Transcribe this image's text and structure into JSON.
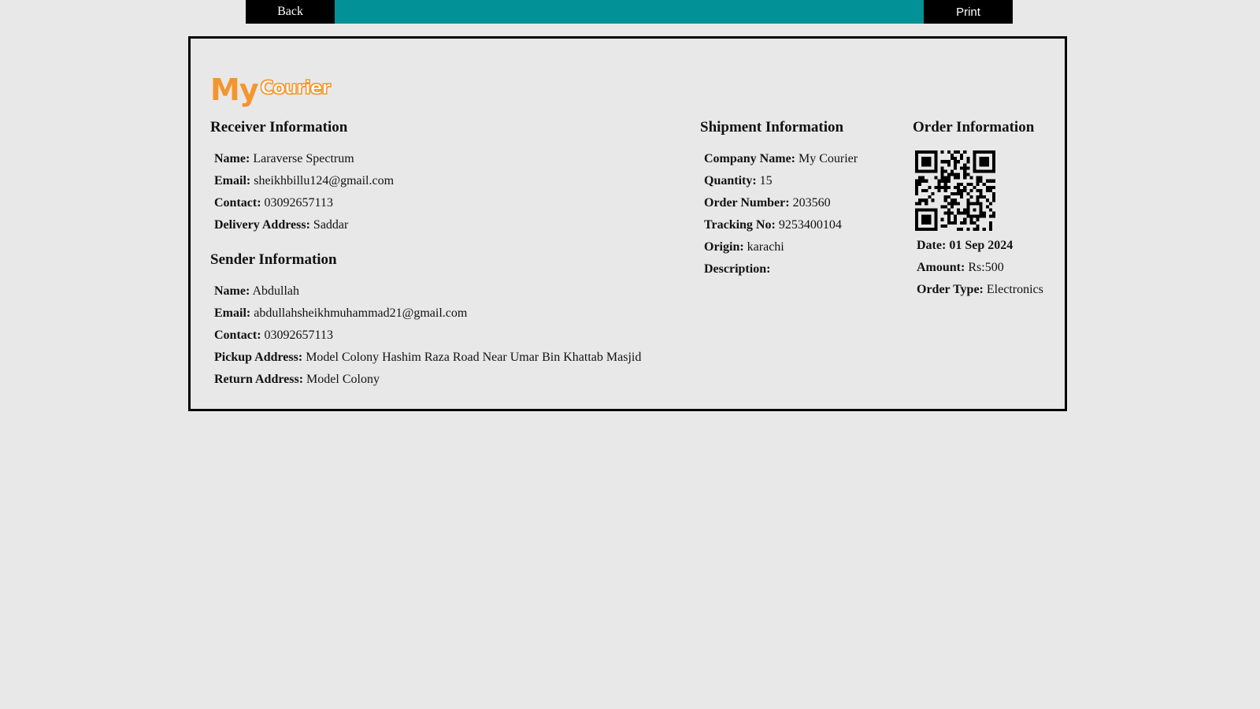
{
  "toolbar": {
    "back_label": "Back",
    "print_label": "Print",
    "bar_color": "#029196"
  },
  "logo": {
    "word1": "My",
    "word2": "Courier",
    "color": "#f4952f"
  },
  "receiver": {
    "title": "Receiver Information",
    "name_label": "Name:",
    "name": "Laraverse Spectrum",
    "email_label": "Email:",
    "email": "sheikhbillu124@gmail.com",
    "contact_label": "Contact:",
    "contact": "03092657113",
    "address_label": "Delivery Address:",
    "address": "Saddar"
  },
  "sender": {
    "title": "Sender Information",
    "name_label": "Name:",
    "name": "Abdullah",
    "email_label": "Email:",
    "email": "abdullahsheikhmuhammad21@gmail.com",
    "contact_label": "Contact:",
    "contact": "03092657113",
    "pickup_label": "Pickup Address:",
    "pickup": "Model Colony Hashim Raza Road Near Umar Bin Khattab Masjid",
    "return_label": "Return Address:",
    "return": "Model Colony"
  },
  "shipment": {
    "title": "Shipment Information",
    "company_label": "Company Name:",
    "company": "My Courier",
    "quantity_label": "Quantity:",
    "quantity": "15",
    "order_number_label": "Order Number:",
    "order_number": "203560",
    "tracking_label": "Tracking No:",
    "tracking": "9253400104",
    "origin_label": "Origin:",
    "origin": "karachi",
    "description_label": "Description:",
    "description": ""
  },
  "order": {
    "title": "Order Information",
    "qr_icon": "qr-code-icon",
    "date_label": "Date:",
    "date": "01 Sep 2024",
    "amount_label": "Amount:",
    "amount": "Rs:500",
    "type_label": "Order Type:",
    "type": "Electronics"
  }
}
